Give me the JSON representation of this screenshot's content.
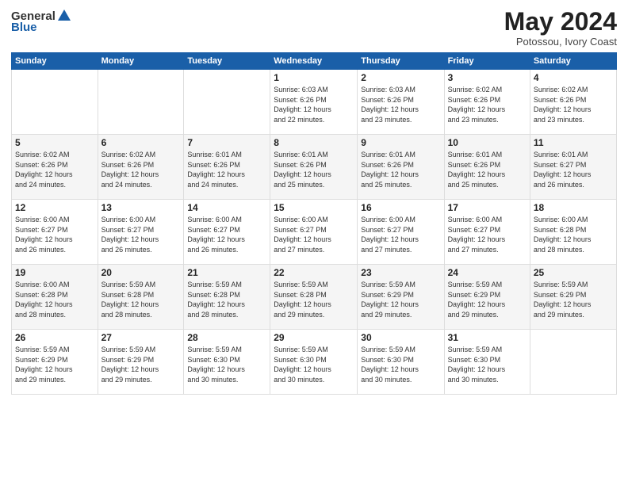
{
  "logo": {
    "general": "General",
    "blue": "Blue"
  },
  "header": {
    "month": "May 2024",
    "location": "Potossou, Ivory Coast"
  },
  "weekdays": [
    "Sunday",
    "Monday",
    "Tuesday",
    "Wednesday",
    "Thursday",
    "Friday",
    "Saturday"
  ],
  "weeks": [
    [
      {
        "day": "",
        "info": ""
      },
      {
        "day": "",
        "info": ""
      },
      {
        "day": "",
        "info": ""
      },
      {
        "day": "1",
        "info": "Sunrise: 6:03 AM\nSunset: 6:26 PM\nDaylight: 12 hours\nand 22 minutes."
      },
      {
        "day": "2",
        "info": "Sunrise: 6:03 AM\nSunset: 6:26 PM\nDaylight: 12 hours\nand 23 minutes."
      },
      {
        "day": "3",
        "info": "Sunrise: 6:02 AM\nSunset: 6:26 PM\nDaylight: 12 hours\nand 23 minutes."
      },
      {
        "day": "4",
        "info": "Sunrise: 6:02 AM\nSunset: 6:26 PM\nDaylight: 12 hours\nand 23 minutes."
      }
    ],
    [
      {
        "day": "5",
        "info": "Sunrise: 6:02 AM\nSunset: 6:26 PM\nDaylight: 12 hours\nand 24 minutes."
      },
      {
        "day": "6",
        "info": "Sunrise: 6:02 AM\nSunset: 6:26 PM\nDaylight: 12 hours\nand 24 minutes."
      },
      {
        "day": "7",
        "info": "Sunrise: 6:01 AM\nSunset: 6:26 PM\nDaylight: 12 hours\nand 24 minutes."
      },
      {
        "day": "8",
        "info": "Sunrise: 6:01 AM\nSunset: 6:26 PM\nDaylight: 12 hours\nand 25 minutes."
      },
      {
        "day": "9",
        "info": "Sunrise: 6:01 AM\nSunset: 6:26 PM\nDaylight: 12 hours\nand 25 minutes."
      },
      {
        "day": "10",
        "info": "Sunrise: 6:01 AM\nSunset: 6:26 PM\nDaylight: 12 hours\nand 25 minutes."
      },
      {
        "day": "11",
        "info": "Sunrise: 6:01 AM\nSunset: 6:27 PM\nDaylight: 12 hours\nand 26 minutes."
      }
    ],
    [
      {
        "day": "12",
        "info": "Sunrise: 6:00 AM\nSunset: 6:27 PM\nDaylight: 12 hours\nand 26 minutes."
      },
      {
        "day": "13",
        "info": "Sunrise: 6:00 AM\nSunset: 6:27 PM\nDaylight: 12 hours\nand 26 minutes."
      },
      {
        "day": "14",
        "info": "Sunrise: 6:00 AM\nSunset: 6:27 PM\nDaylight: 12 hours\nand 26 minutes."
      },
      {
        "day": "15",
        "info": "Sunrise: 6:00 AM\nSunset: 6:27 PM\nDaylight: 12 hours\nand 27 minutes."
      },
      {
        "day": "16",
        "info": "Sunrise: 6:00 AM\nSunset: 6:27 PM\nDaylight: 12 hours\nand 27 minutes."
      },
      {
        "day": "17",
        "info": "Sunrise: 6:00 AM\nSunset: 6:27 PM\nDaylight: 12 hours\nand 27 minutes."
      },
      {
        "day": "18",
        "info": "Sunrise: 6:00 AM\nSunset: 6:28 PM\nDaylight: 12 hours\nand 28 minutes."
      }
    ],
    [
      {
        "day": "19",
        "info": "Sunrise: 6:00 AM\nSunset: 6:28 PM\nDaylight: 12 hours\nand 28 minutes."
      },
      {
        "day": "20",
        "info": "Sunrise: 5:59 AM\nSunset: 6:28 PM\nDaylight: 12 hours\nand 28 minutes."
      },
      {
        "day": "21",
        "info": "Sunrise: 5:59 AM\nSunset: 6:28 PM\nDaylight: 12 hours\nand 28 minutes."
      },
      {
        "day": "22",
        "info": "Sunrise: 5:59 AM\nSunset: 6:28 PM\nDaylight: 12 hours\nand 29 minutes."
      },
      {
        "day": "23",
        "info": "Sunrise: 5:59 AM\nSunset: 6:29 PM\nDaylight: 12 hours\nand 29 minutes."
      },
      {
        "day": "24",
        "info": "Sunrise: 5:59 AM\nSunset: 6:29 PM\nDaylight: 12 hours\nand 29 minutes."
      },
      {
        "day": "25",
        "info": "Sunrise: 5:59 AM\nSunset: 6:29 PM\nDaylight: 12 hours\nand 29 minutes."
      }
    ],
    [
      {
        "day": "26",
        "info": "Sunrise: 5:59 AM\nSunset: 6:29 PM\nDaylight: 12 hours\nand 29 minutes."
      },
      {
        "day": "27",
        "info": "Sunrise: 5:59 AM\nSunset: 6:29 PM\nDaylight: 12 hours\nand 29 minutes."
      },
      {
        "day": "28",
        "info": "Sunrise: 5:59 AM\nSunset: 6:30 PM\nDaylight: 12 hours\nand 30 minutes."
      },
      {
        "day": "29",
        "info": "Sunrise: 5:59 AM\nSunset: 6:30 PM\nDaylight: 12 hours\nand 30 minutes."
      },
      {
        "day": "30",
        "info": "Sunrise: 5:59 AM\nSunset: 6:30 PM\nDaylight: 12 hours\nand 30 minutes."
      },
      {
        "day": "31",
        "info": "Sunrise: 5:59 AM\nSunset: 6:30 PM\nDaylight: 12 hours\nand 30 minutes."
      },
      {
        "day": "",
        "info": ""
      }
    ]
  ]
}
